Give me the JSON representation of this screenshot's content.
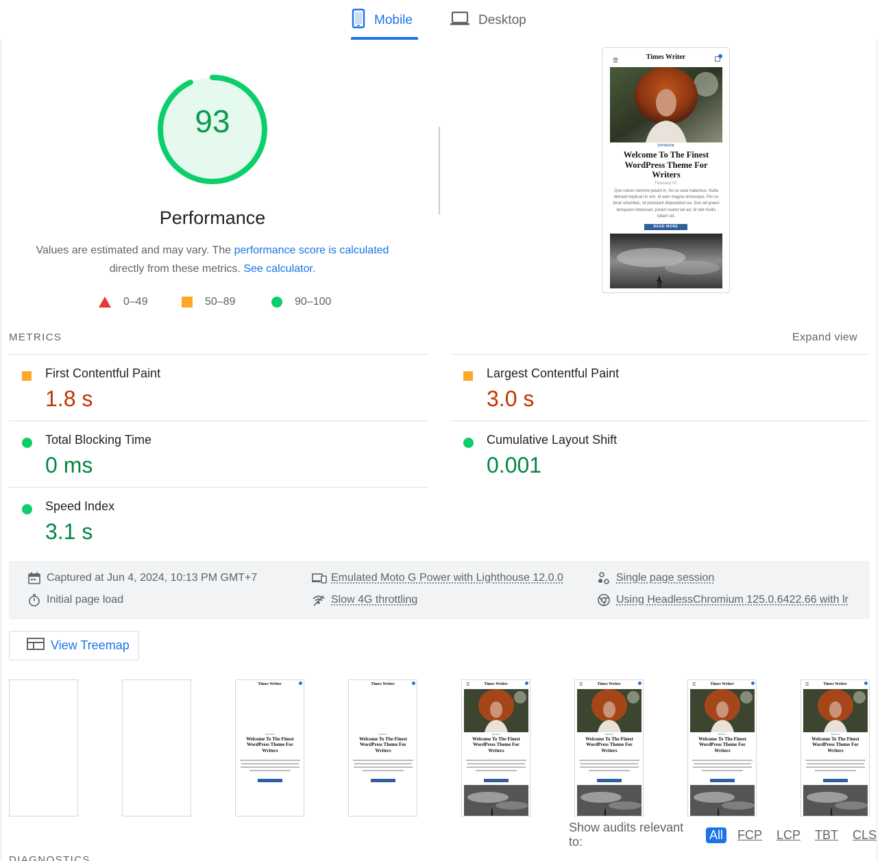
{
  "tabs": [
    {
      "label": "Mobile",
      "active": true
    },
    {
      "label": "Desktop",
      "active": false
    }
  ],
  "score": {
    "value": "93",
    "fraction": 0.93,
    "title": "Performance",
    "desc_prefix": "Values are estimated and may vary. The ",
    "desc_link": "performance score is calculated",
    "desc_middle": "directly from these metrics. ",
    "desc_link2": "See calculator",
    "desc_suffix": "."
  },
  "legend": {
    "poor": "0–49",
    "average": "50–89",
    "good": "90–100"
  },
  "preview": {
    "site_title": "Times Writer",
    "category": "OPINION",
    "headline": "Welcome To The Finest WordPress Theme For Writers",
    "date": "February 01",
    "excerpt": "Quo natum nemore putant in, his te case habemus. Nulla detraxit explicari in vim. Id eam magna omnesque. Per cu dicat urbanitas, sit postulant disputationi ea. Duo ad graeci tamquam interesset, putant svaret vel ad. Id stet mollis tollam ret.",
    "button": "READ MORE"
  },
  "metrics": {
    "section_label": "METRICS",
    "expand_label": "Expand view",
    "items": [
      {
        "name": "First Contentful Paint",
        "value": "1.8 s",
        "rating": "average"
      },
      {
        "name": "Largest Contentful Paint",
        "value": "3.0 s",
        "rating": "average"
      },
      {
        "name": "Total Blocking Time",
        "value": "0 ms",
        "rating": "good"
      },
      {
        "name": "Cumulative Layout Shift",
        "value": "0.001",
        "rating": "good"
      },
      {
        "name": "Speed Index",
        "value": "3.1 s",
        "rating": "good"
      }
    ]
  },
  "env": {
    "captured": "Captured at Jun 4, 2024, 10:13 PM GMT+7",
    "load": "Initial page load",
    "device": "Emulated Moto G Power with Lighthouse 12.0.0",
    "throttling": "Slow 4G throttling",
    "session": "Single page session",
    "browser": "Using HeadlessChromium 125.0.6422.66 with lr"
  },
  "treemap": {
    "label": "View Treemap"
  },
  "filmstrip": {
    "site_title": "Times Writer",
    "category": "OPINION",
    "headline": "Welcome To The Finest WordPress Theme For Writers",
    "frames": [
      "blank",
      "blank",
      "text",
      "text",
      "full",
      "full",
      "full",
      "full"
    ]
  },
  "audit_filter": {
    "lead": "Show audits relevant to:",
    "chips": [
      "All",
      "FCP",
      "LCP",
      "TBT",
      "CLS"
    ],
    "active": "All"
  },
  "diagnostics_label": "DIAGNOSTICS",
  "colors": {
    "accent": "#1a73e8",
    "pass": "#0cce6b",
    "average": "#ffa726",
    "fail": "#e53935",
    "pass_text": "#018642",
    "average_text": "#c33300"
  }
}
